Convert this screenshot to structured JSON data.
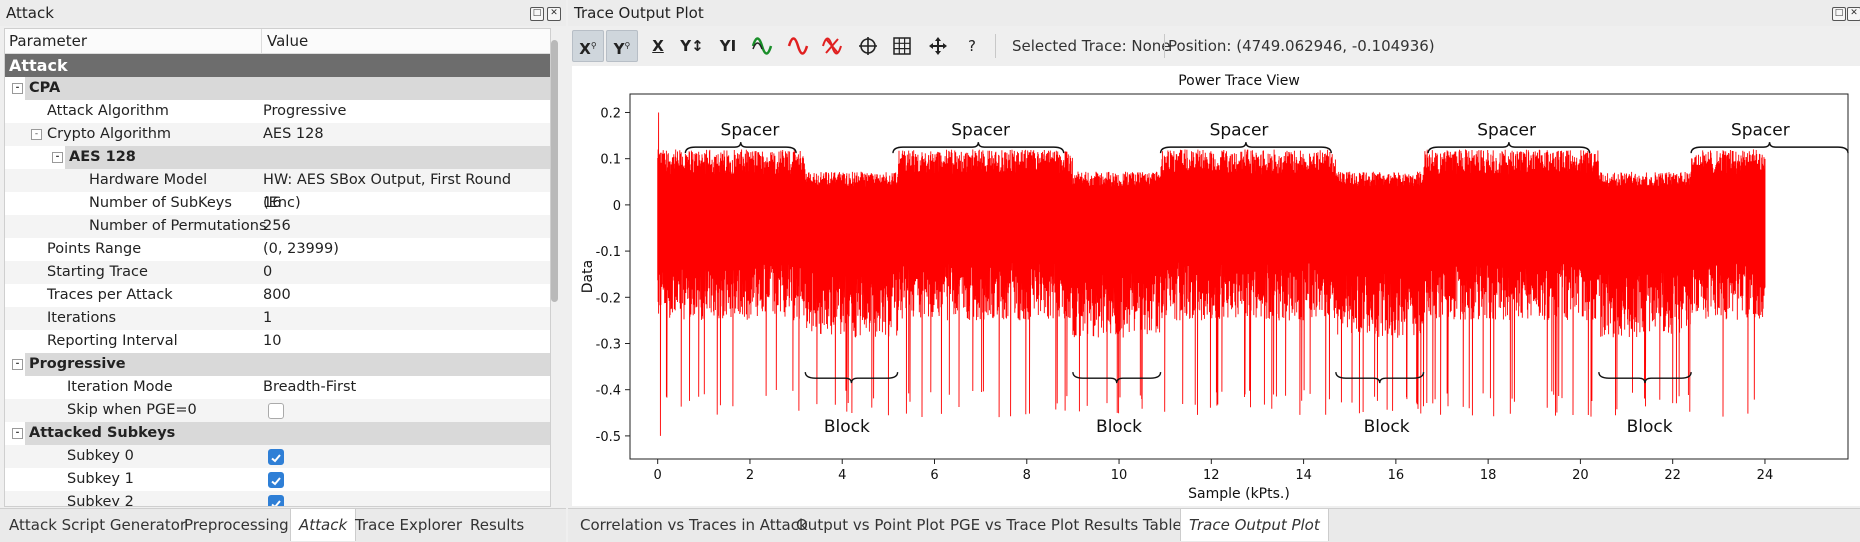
{
  "left_dock": {
    "title": "Attack",
    "float_icon": "float-icon",
    "close_icon": "close-icon",
    "tree": {
      "col_parameter": "Parameter",
      "col_value": "Value",
      "rows": [
        {
          "kind": "top",
          "name": "Attack"
        },
        {
          "kind": "group",
          "name": "CPA",
          "expander": "-"
        },
        {
          "kind": "item",
          "name": "Attack Algorithm",
          "value": "Progressive"
        },
        {
          "kind": "item",
          "name": "Crypto Algorithm",
          "value": "AES 128",
          "expander": "-"
        },
        {
          "kind": "group2",
          "name": "AES 128",
          "expander": "-"
        },
        {
          "kind": "item",
          "name": "Hardware Model",
          "value": "HW: AES SBox Output, First Round (Enc)"
        },
        {
          "kind": "item",
          "name": "Number of SubKeys",
          "value": "16"
        },
        {
          "kind": "item",
          "name": "Number of Permutations",
          "value": "256"
        },
        {
          "kind": "item",
          "name": "Points Range",
          "value": "(0, 23999)"
        },
        {
          "kind": "item",
          "name": "Starting Trace",
          "value": "0"
        },
        {
          "kind": "item",
          "name": "Traces per Attack",
          "value": "800"
        },
        {
          "kind": "item",
          "name": "Iterations",
          "value": "1"
        },
        {
          "kind": "item",
          "name": "Reporting Interval",
          "value": "10"
        },
        {
          "kind": "group",
          "name": "Progressive",
          "expander": "-"
        },
        {
          "kind": "item",
          "name": "Iteration Mode",
          "value": "Breadth-First"
        },
        {
          "kind": "item",
          "name": "Skip when PGE=0",
          "checkbox": false
        },
        {
          "kind": "group",
          "name": "Attacked Subkeys",
          "expander": "-"
        },
        {
          "kind": "item",
          "name": "Subkey 0",
          "checkbox": true
        },
        {
          "kind": "item",
          "name": "Subkey 1",
          "checkbox": true
        },
        {
          "kind": "item",
          "name": "Subkey 2",
          "checkbox": true
        }
      ]
    },
    "tabs": [
      "Attack Script Generator",
      "Preprocessing",
      "Attack",
      "Trace Explorer",
      "Results"
    ],
    "active_tab": "Attack"
  },
  "right_dock": {
    "title": "Trace Output Plot",
    "toolbar": {
      "buttons": [
        {
          "name": "x-lock-button",
          "label": "X\u0001"
        },
        {
          "name": "y-lock-button",
          "label": "Y"
        },
        {
          "name": "x-autoscale-button",
          "label": "X"
        },
        {
          "name": "y-autoscale-button",
          "label": "Y↕"
        },
        {
          "name": "y-default-button",
          "label": "YI"
        },
        {
          "name": "show-trace-button",
          "label": "~"
        },
        {
          "name": "hide-trace-button",
          "label": "~"
        },
        {
          "name": "clear-traces-button",
          "label": "✕"
        },
        {
          "name": "crosshair-button",
          "label": "⊕"
        },
        {
          "name": "grid-button",
          "label": "#"
        },
        {
          "name": "pan-button",
          "label": "✥"
        },
        {
          "name": "help-button",
          "label": "?"
        }
      ],
      "selected_trace": "Selected Trace: None",
      "position": "Position: (4749.062946, -0.104936)"
    },
    "tabs": [
      "Correlation vs Traces in Attack",
      "Output vs Point Plot",
      "PGE vs Trace Plot",
      "Results Table",
      "Trace Output Plot"
    ],
    "active_tab": "Trace Output Plot"
  },
  "chart_data": {
    "type": "line",
    "title": "Power Trace View",
    "xlabel": "Sample (kPts.)",
    "ylabel": "Data",
    "xlim": [
      -0.6,
      25.8
    ],
    "ylim": [
      -0.55,
      0.24
    ],
    "x_ticks": [
      0,
      2,
      4,
      6,
      8,
      10,
      12,
      14,
      16,
      18,
      20,
      22,
      24
    ],
    "y_ticks": [
      0.2,
      0.1,
      0,
      -0.1,
      -0.2,
      -0.3,
      -0.4,
      -0.5
    ],
    "y_tick_labels": [
      "0.2",
      "0.1",
      "0",
      "-0.1",
      "-0.2",
      "-0.3",
      "-0.4",
      "-0.5"
    ],
    "series_color": "#ff0000",
    "x_range": [
      0,
      24
    ],
    "envelope": {
      "upper_typical": 0.12,
      "lower_typical": -0.25,
      "max_peak": 0.2,
      "min_peak": -0.5
    },
    "annotations": [
      {
        "text": "Spacer",
        "x": 2.0,
        "y": 0.15,
        "bracket": [
          0.6,
          3.0
        ],
        "side": "top"
      },
      {
        "text": "Spacer",
        "x": 7.0,
        "y": 0.15,
        "bracket": [
          5.1,
          8.8
        ],
        "side": "top"
      },
      {
        "text": "Spacer",
        "x": 12.6,
        "y": 0.15,
        "bracket": [
          10.9,
          14.6
        ],
        "side": "top"
      },
      {
        "text": "Spacer",
        "x": 18.4,
        "y": 0.15,
        "bracket": [
          16.7,
          20.2
        ],
        "side": "top"
      },
      {
        "text": "Spacer",
        "x": 23.9,
        "y": 0.15,
        "bracket": [
          22.4,
          25.8
        ],
        "side": "top"
      },
      {
        "text": "Block",
        "x": 4.1,
        "y": -0.47,
        "bracket": [
          3.2,
          5.2
        ],
        "side": "bottom"
      },
      {
        "text": "Block",
        "x": 10.0,
        "y": -0.47,
        "bracket": [
          9.0,
          10.9
        ],
        "side": "bottom"
      },
      {
        "text": "Block",
        "x": 15.8,
        "y": -0.47,
        "bracket": [
          14.7,
          16.6
        ],
        "side": "bottom"
      },
      {
        "text": "Block",
        "x": 21.5,
        "y": -0.47,
        "bracket": [
          20.4,
          22.4
        ],
        "side": "bottom"
      }
    ]
  }
}
